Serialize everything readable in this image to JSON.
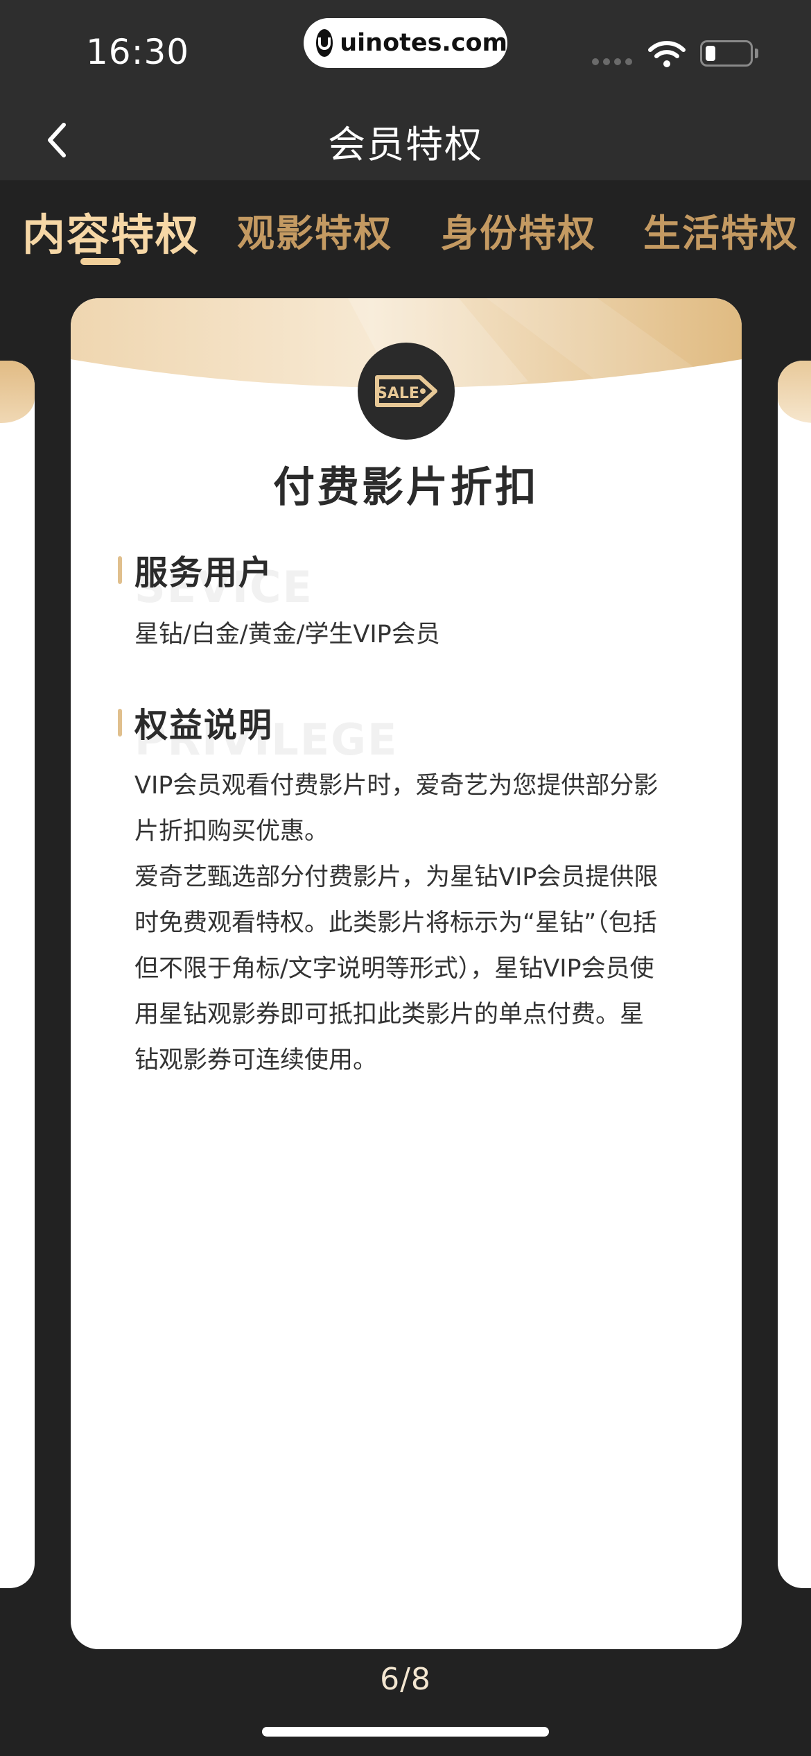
{
  "status_bar": {
    "time": "16:30",
    "url": "uinotes.com"
  },
  "nav": {
    "title": "会员特权",
    "back_icon": "chevron-left-icon"
  },
  "tabs": [
    {
      "label": "内容特权",
      "active": true
    },
    {
      "label": "观影特权",
      "active": false
    },
    {
      "label": "身份特权",
      "active": false
    },
    {
      "label": "生活特权",
      "active": false
    }
  ],
  "card": {
    "icon": "sale-tag-icon",
    "icon_text": "SALE",
    "title": "付费影片折扣",
    "sections": [
      {
        "watermark": "SEVICE",
        "title": "服务用户",
        "text": "星钻/白金/黄金/学生VIP会员"
      },
      {
        "watermark": "PRIVILEGE",
        "title": "权益说明",
        "text": "VIP会员观看付费影片时，爱奇艺为您提供部分影片折扣购买优惠。爱奇艺甄选部分付费影片，为星钻VIP会员提供限时免费观看特权。此类影片将标示为“星钻”（包括但不限于角标/文字说明等形式），星钻VIP会员使用星钻观影券即可抵扣此类影片的单点付费。星钻观影券可连续使用。",
        "lines": [
          "VIP会员观看付费影片时，爱奇艺为您提供部分影",
          "片折扣购买优惠。",
          "爱奇艺甄选部分付费影片，为星钻VIP会员提供限",
          "时免费观看特权。此类影片将标示为“星钻”（包括",
          "但不限于角标/文字说明等形式），星钻VIP会员使",
          "用星钻观影券即可抵扣此类影片的单点付费。星",
          "钻观影券可连续使用。"
        ]
      }
    ]
  },
  "pager": "6/8",
  "colors": {
    "background": "#222222",
    "gold_active": "#f6d7a6",
    "gold_tab": "#c49a62",
    "accent_bar": "#e0bf8d"
  }
}
